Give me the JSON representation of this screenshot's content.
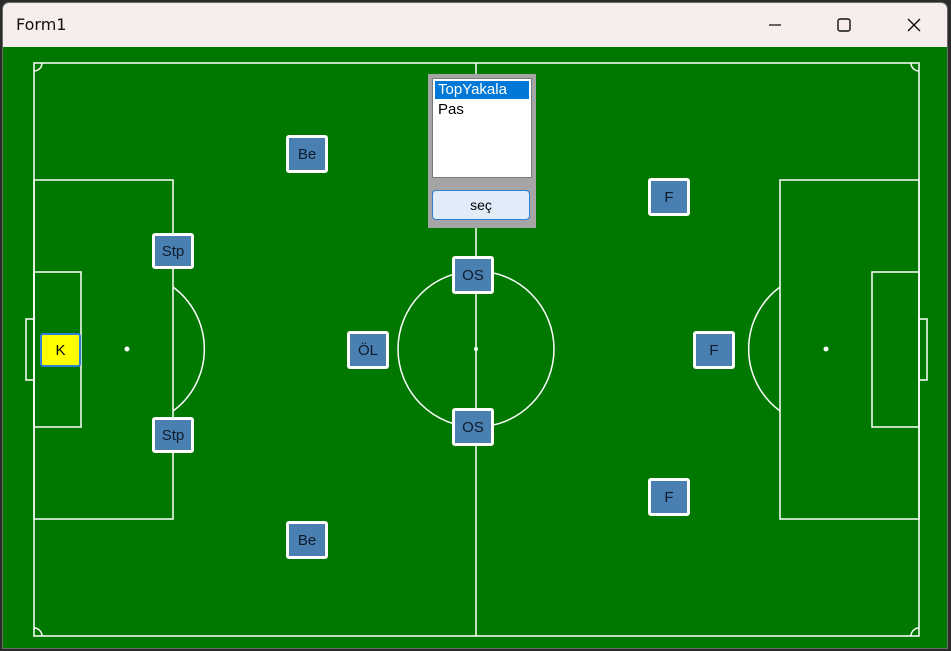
{
  "window": {
    "title": "Form1"
  },
  "controls": {
    "minimize_icon": "minimize-icon",
    "maximize_icon": "maximize-icon",
    "close_icon": "close-icon"
  },
  "colors": {
    "pitch": "#007800",
    "player_fill": "#4a7fb2",
    "keeper_fill": "#ffff00",
    "selection": "#0078d7"
  },
  "players": {
    "keeper": "K",
    "stopper_top": "Stp",
    "stopper_bottom": "Stp",
    "back_top": "Be",
    "back_bottom": "Be",
    "defensive_mid": "ÖL",
    "central_mid_top": "OS",
    "central_mid_bottom": "OS",
    "forward_top": "F",
    "forward_center": "F",
    "forward_bottom": "F"
  },
  "action_panel": {
    "options": [
      "TopYakala",
      "Pas"
    ],
    "selected": "TopYakala",
    "button_label": "seç"
  }
}
